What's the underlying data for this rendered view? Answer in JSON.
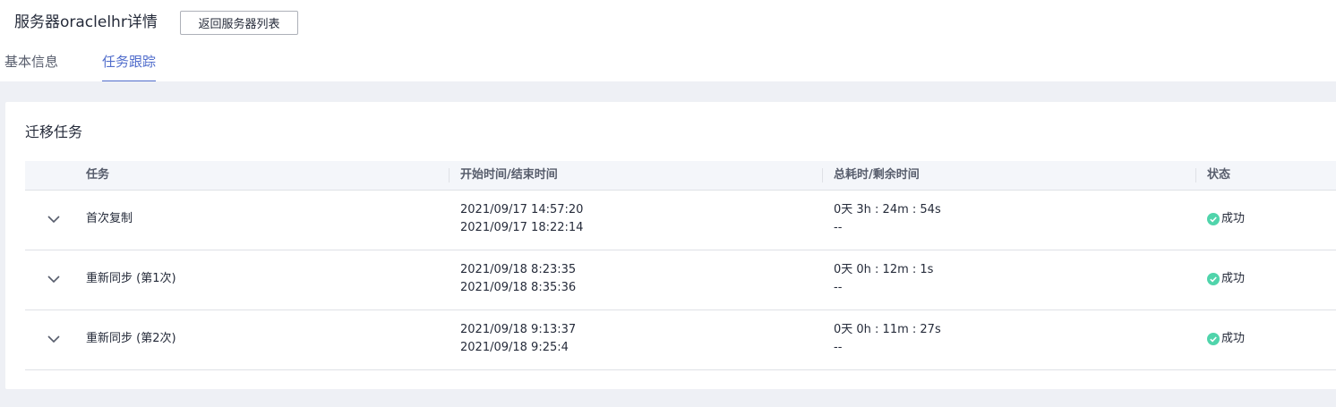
{
  "header": {
    "title": "服务器oraclelhr详情",
    "back_button": "返回服务器列表"
  },
  "tabs": [
    {
      "label": "基本信息",
      "active": false
    },
    {
      "label": "任务跟踪",
      "active": true
    }
  ],
  "section": {
    "title": "迁移任务"
  },
  "table": {
    "columns": [
      "任务",
      "开始时间/结束时间",
      "总耗时/剩余时间",
      "状态"
    ],
    "rows": [
      {
        "task": "首次复制",
        "start": "2021/09/17 14:57:20",
        "end": "2021/09/17 18:22:14",
        "elapsed": "0天 3h : 24m : 54s",
        "remaining": "--",
        "status": "成功"
      },
      {
        "task": "重新同步 (第1次)",
        "start": "2021/09/18 8:23:35",
        "end": "2021/09/18 8:35:36",
        "elapsed": "0天 0h : 12m : 1s",
        "remaining": "--",
        "status": "成功"
      },
      {
        "task": "重新同步 (第2次)",
        "start": "2021/09/18 9:13:37",
        "end": "2021/09/18 9:25:4",
        "elapsed": "0天 0h : 11m : 27s",
        "remaining": "--",
        "status": "成功"
      }
    ]
  },
  "colors": {
    "accent": "#526ecc",
    "success": "#50d4ab",
    "header_bg": "#f4f6fa",
    "page_bg": "#eef0f5"
  },
  "icons": {
    "expand": "chevron-down-icon",
    "status": "check-circle-icon"
  }
}
